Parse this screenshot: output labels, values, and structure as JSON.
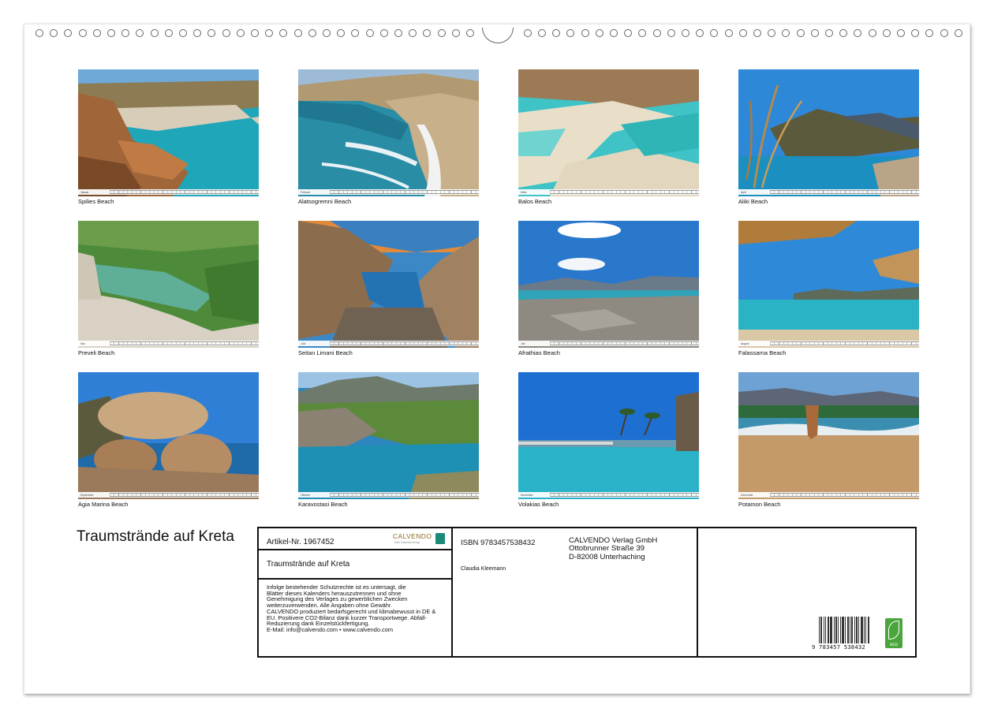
{
  "photos": [
    {
      "month": "Januar",
      "caption": "Spilies Beach"
    },
    {
      "month": "Februar",
      "caption": "Alatsogremni Beach"
    },
    {
      "month": "März",
      "caption": "Balos Beach"
    },
    {
      "month": "April",
      "caption": "Aliki Beach"
    },
    {
      "month": "Mai",
      "caption": "Preveli Beach"
    },
    {
      "month": "Juni",
      "caption": "Seitan Limani Beach"
    },
    {
      "month": "Juli",
      "caption": "Afrathias Beach"
    },
    {
      "month": "August",
      "caption": "Falassarna Beach"
    },
    {
      "month": "September",
      "caption": "Agia Marina Beach"
    },
    {
      "month": "Oktober",
      "caption": "Karavostasi Beach"
    },
    {
      "month": "November",
      "caption": "Volakias Beach"
    },
    {
      "month": "Dezember",
      "caption": "Potamon Beach"
    }
  ],
  "title": "Traumstrände auf Kreta",
  "info": {
    "article": "Artikel-Nr. 1967452",
    "logo_text": "CALVENDO",
    "logo_sub": "Dein Kalenderverlag",
    "subtitle": "Traumstrände auf Kreta",
    "legal_lines": [
      "Infolge bestehender Schutzrechte ist es untersagt, die",
      "Blätter dieses Kalenders herauszutrennen und ohne",
      "Genehmigung des Verlages zu gewerblichen Zwecken",
      "weiterzuverwenden. Alle Angaben ohne Gewähr.",
      "CALVENDO produziert bedarfsgerecht und klimabewusst in DE &",
      "EU. Positivere CO2-Bilanz dank kurzer Transportwege. Abfall-",
      "Reduzierung dank Einzelstückfertigung.",
      "E-Mail: info@calvendo.com • www.calvendo.com"
    ],
    "isbn": "ISBN 9783457538432",
    "author": "Claudia Kleemann",
    "publisher_lines": [
      "CALVENDO Verlag GmbH",
      "Ottobrunner Straße 39",
      "D-82008 Unterhaching"
    ],
    "barcode_number": "9 783457 538432",
    "eco_label": "eco"
  },
  "colors": {
    "sea": "#1fa6b8",
    "sky": "#3d8fd8",
    "sand": "#cdb497",
    "rock": "#a0663a",
    "eco_green": "#4aa63c",
    "calvendo_gold": "#8a6a1c",
    "calvendo_teal": "#1c8a78"
  }
}
